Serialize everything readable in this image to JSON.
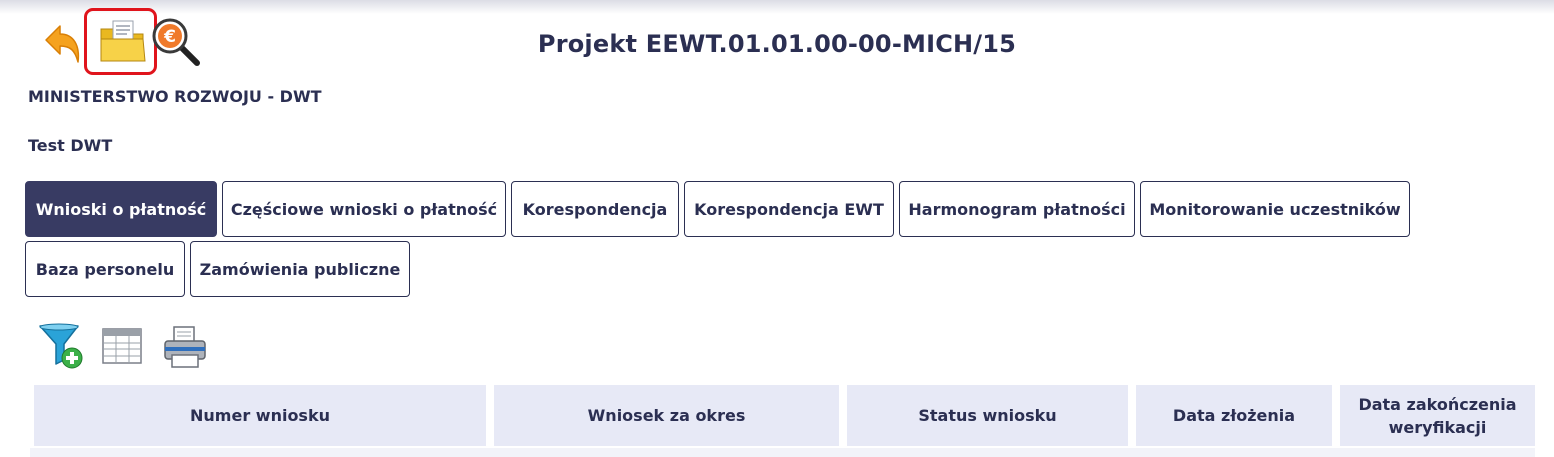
{
  "header": {
    "title": "Projekt EEWT.01.01.00-00-MICH/15",
    "institution": "MINISTERSTWO ROZWOJU - DWT",
    "beneficiary": "Test DWT"
  },
  "toolbar": {
    "icons": [
      "back-arrow-icon",
      "project-folder-icon",
      "euro-magnifier-icon"
    ]
  },
  "tabs": [
    {
      "label": "Wnioski o płatność",
      "active": true
    },
    {
      "label": "Częściowe wnioski o płatność",
      "active": false
    },
    {
      "label": "Korespondencja",
      "active": false
    },
    {
      "label": "Korespondencja EWT",
      "active": false
    },
    {
      "label": "Harmonogram płatności",
      "active": false
    },
    {
      "label": "Monitorowanie uczestników",
      "active": false
    },
    {
      "label": "Baza personelu",
      "active": false
    },
    {
      "label": "Zamówienia publiczne",
      "active": false
    }
  ],
  "table_tools": [
    "add-filter-icon",
    "table-columns-icon",
    "print-icon"
  ],
  "table": {
    "columns": [
      "Numer wniosku",
      "Wniosek za okres",
      "Status wniosku",
      "Data złożenia",
      "Data zakończenia weryfikacji"
    ]
  },
  "colors": {
    "accent": "#383b63",
    "text": "#2b2f52",
    "header_bg": "#e7e9f6",
    "highlight_box": "#e0141c"
  }
}
